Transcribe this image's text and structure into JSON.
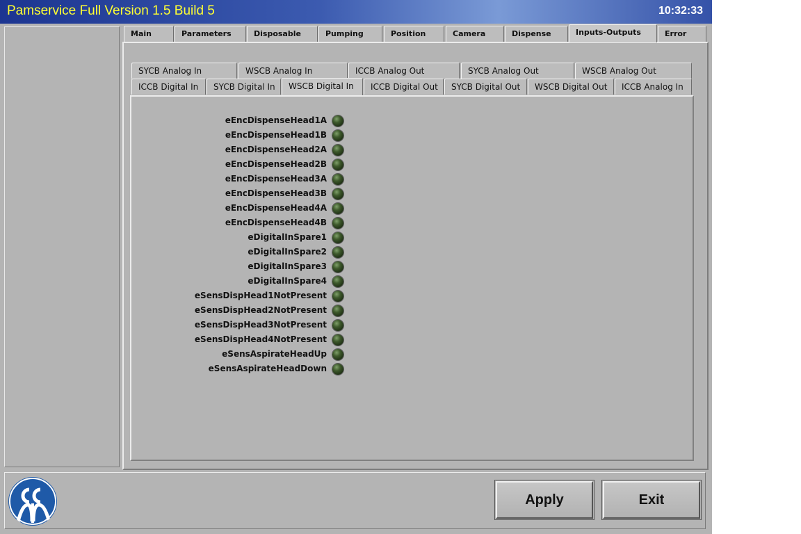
{
  "window": {
    "title": "Pamservice Full Version 1.5 Build 5",
    "clock": "10:32:33"
  },
  "main_tabs": [
    "Main",
    "Parameters",
    "Disposable",
    "Pumping",
    "Position",
    "Camera",
    "Dispense",
    "Inputs-Outputs",
    "Error"
  ],
  "main_tab_active": "Inputs-Outputs",
  "sub_tabs_row1": [
    "SYCB Analog In",
    "WSCB Analog In",
    "ICCB Analog Out",
    "SYCB Analog Out",
    "WSCB Analog Out"
  ],
  "sub_tabs_row2": [
    "ICCB Digital In",
    "SYCB Digital In",
    "WSCB Digital In",
    "ICCB Digital Out",
    "SYCB Digital Out",
    "WSCB Digital Out",
    "ICCB Analog In"
  ],
  "sub_tab_active": "WSCB Digital In",
  "inputs": [
    {
      "label": "eEncDispenseHead1A"
    },
    {
      "label": "eEncDispenseHead1B"
    },
    {
      "label": "eEncDispenseHead2A"
    },
    {
      "label": "eEncDispenseHead2B"
    },
    {
      "label": "eEncDispenseHead3A"
    },
    {
      "label": "eEncDispenseHead3B"
    },
    {
      "label": "eEncDispenseHead4A"
    },
    {
      "label": "eEncDispenseHead4B"
    },
    {
      "label": "eDigitalInSpare1"
    },
    {
      "label": "eDigitalInSpare2"
    },
    {
      "label": "eDigitalInSpare3"
    },
    {
      "label": "eDigitalInSpare4"
    },
    {
      "label": "eSensDispHead1NotPresent"
    },
    {
      "label": "eSensDispHead2NotPresent"
    },
    {
      "label": "eSensDispHead3NotPresent"
    },
    {
      "label": "eSensDispHead4NotPresent"
    },
    {
      "label": "eSensAspirateHeadUp"
    },
    {
      "label": "eSensAspirateHeadDown"
    }
  ],
  "input_state": "off",
  "buttons": {
    "apply": "Apply",
    "exit": "Exit"
  },
  "colors": {
    "title_text": "#ffff33",
    "led_off": "#2e4a20",
    "background": "#b4b4b4"
  }
}
